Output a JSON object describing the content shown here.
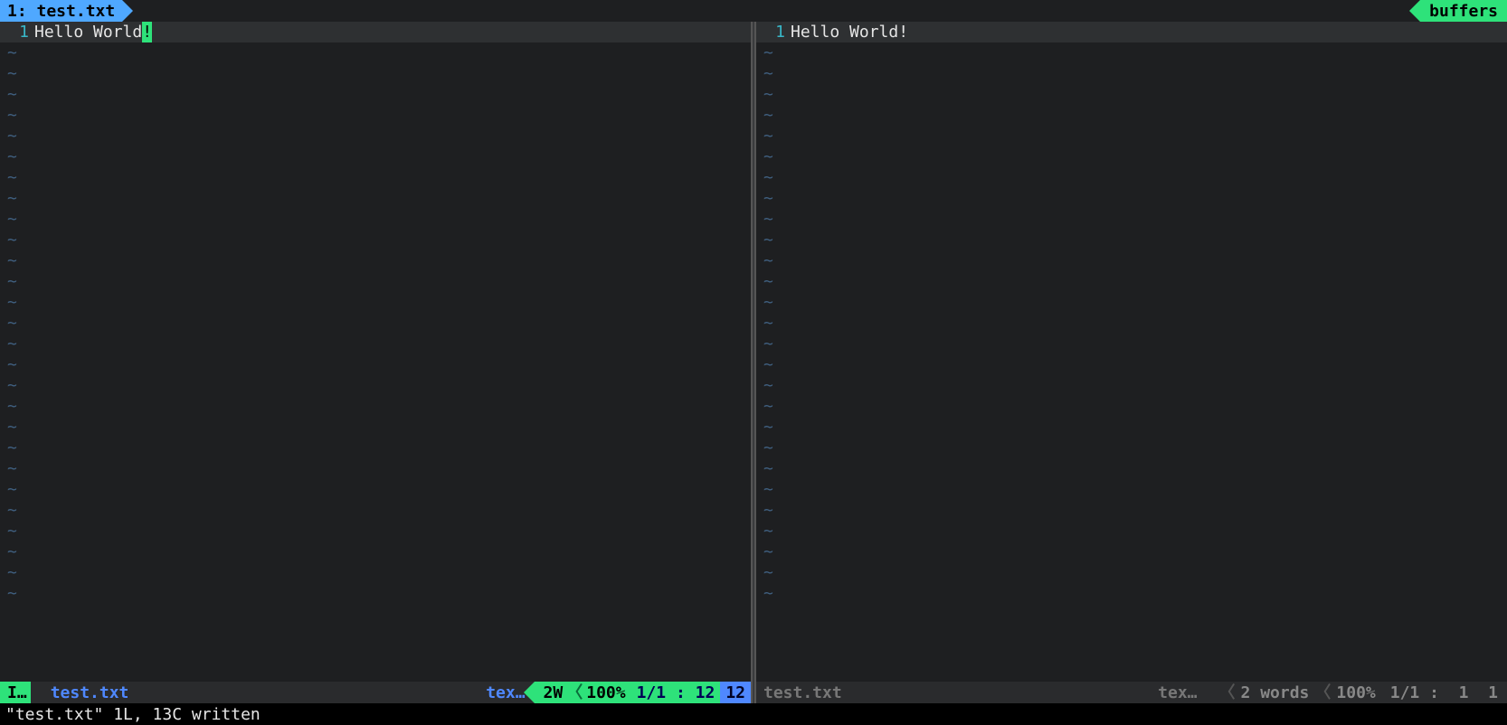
{
  "tabbar": {
    "tab_label": "1: test.txt",
    "buffers_label": "buffers"
  },
  "panes": {
    "left": {
      "line_number": "1",
      "line_text": "Hello World",
      "cursor_char": "!",
      "status": {
        "mode": "I…",
        "filename": "test.txt",
        "filetype": "tex…",
        "words": "2W",
        "percent": "100%",
        "line_total": "1/1",
        "sep": ":",
        "col": "12",
        "colbox": "12"
      }
    },
    "right": {
      "line_number": "1",
      "line_text": "Hello World!",
      "status": {
        "filename": "test.txt",
        "filetype": "tex…",
        "words": "2 words",
        "percent": "100%",
        "line_total": "1/1",
        "sep": ":",
        "col1": "1",
        "col2": "1"
      }
    }
  },
  "cmdline": "\"test.txt\" 1L, 13C written",
  "tilde": "~",
  "empty_tilde_rows": 27
}
